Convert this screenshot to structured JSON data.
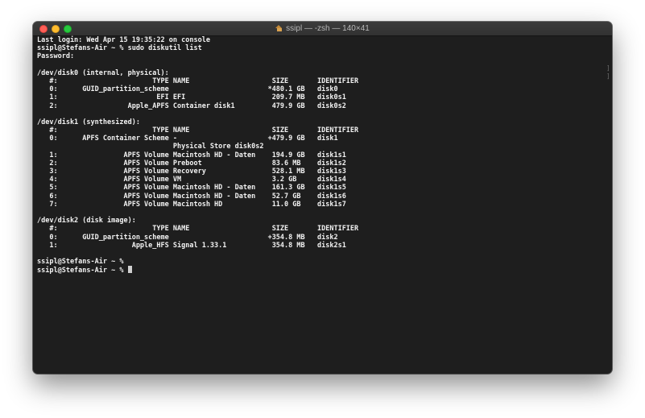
{
  "window": {
    "title": "ssipl — -zsh — 140×41",
    "icon": "home-icon",
    "colors": {
      "background": "#1e1e1e",
      "text": "#f2f2f2",
      "titlebar": "#363636"
    }
  },
  "terminal": {
    "lines": [
      "Last login: Wed Apr 15 19:35:22 on console",
      "ssipl@Stefans-Air ~ % sudo diskutil list",
      "Password:",
      "",
      "/dev/disk0 (internal, physical):",
      "   #:                       TYPE NAME                    SIZE       IDENTIFIER",
      "   0:      GUID_partition_scheme                        *480.1 GB   disk0",
      "   1:                        EFI EFI                     209.7 MB   disk0s1",
      "   2:                 Apple_APFS Container disk1         479.9 GB   disk0s2",
      "",
      "/dev/disk1 (synthesized):",
      "   #:                       TYPE NAME                    SIZE       IDENTIFIER",
      "   0:      APFS Container Scheme -                      +479.9 GB   disk1",
      "                                 Physical Store disk0s2",
      "   1:                APFS Volume Macintosh HD - Daten    194.9 GB   disk1s1",
      "   2:                APFS Volume Preboot                 83.6 MB    disk1s2",
      "   3:                APFS Volume Recovery                528.1 MB   disk1s3",
      "   4:                APFS Volume VM                      3.2 GB     disk1s4",
      "   5:                APFS Volume Macintosh HD - Daten    161.3 GB   disk1s5",
      "   6:                APFS Volume Macintosh HD - Daten    52.7 GB    disk1s6",
      "   7:                APFS Volume Macintosh HD            11.0 GB    disk1s7",
      "",
      "/dev/disk2 (disk image):",
      "   #:                       TYPE NAME                    SIZE       IDENTIFIER",
      "   0:      GUID_partition_scheme                        +354.8 MB   disk2",
      "   1:                  Apple_HFS Signal 1.33.1           354.8 MB   disk2s1",
      "",
      "ssipl@Stefans-Air ~ %"
    ],
    "prompt": "ssipl@Stefans-Air ~ % "
  }
}
